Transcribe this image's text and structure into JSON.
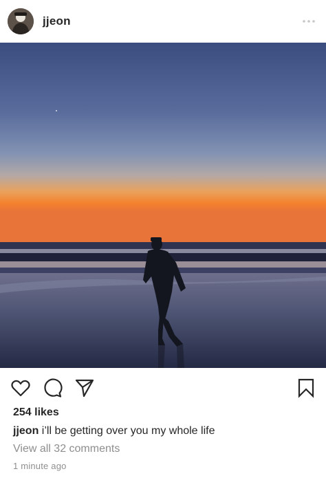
{
  "post": {
    "username": "jjeon",
    "avatar_icon": "profile-photo",
    "more_icon": "more-options-icon",
    "photo_description_icon": "sunset-beach-silhouette-photo"
  },
  "actions": {
    "like_icon": "heart-icon",
    "comment_icon": "comment-bubble-icon",
    "share_icon": "paper-plane-icon",
    "save_icon": "bookmark-icon"
  },
  "likes": "254 likes",
  "caption": {
    "user": "jjeon",
    "text": "i’ll be getting over you my whole life"
  },
  "comments_link": "View all 32 comments",
  "timestamp": "1 minute ago",
  "colors": {
    "text": "#262626",
    "secondary": "#8e8e8e",
    "sky_top": "#3d4f7e",
    "horizon_orange": "#f5883a"
  }
}
